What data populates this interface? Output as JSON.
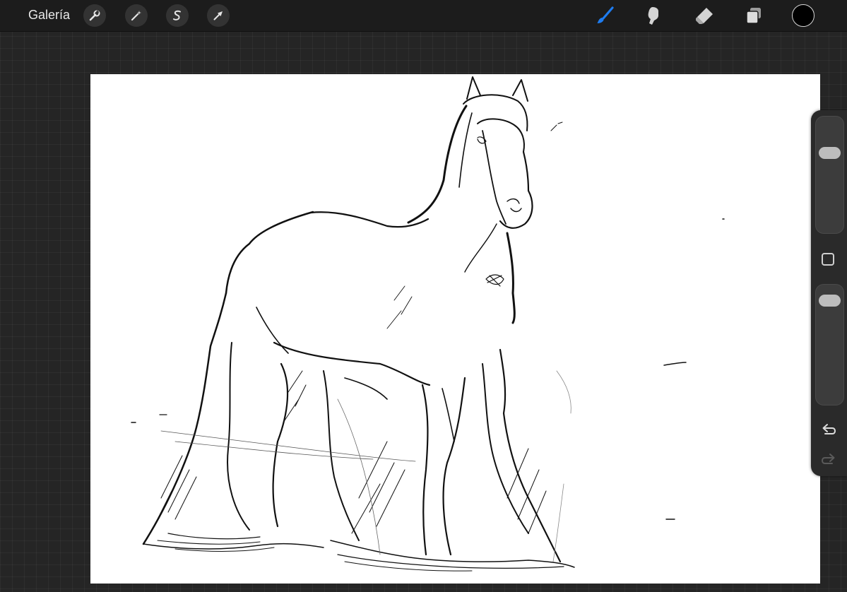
{
  "toolbar": {
    "gallery_label": "Galería",
    "left_tools": [
      "wrench-icon",
      "magic-wand-icon",
      "selection-s-icon",
      "arrow-icon"
    ],
    "right_tools": [
      "brush-icon",
      "smudge-icon",
      "eraser-icon",
      "layers-icon"
    ],
    "active_tool": "brush-icon",
    "active_color": "#1e7cf0",
    "current_color": "#000000"
  },
  "sidebar": {
    "brush_size_level": 0.72,
    "opacity_level": 0.93,
    "icons": [
      "modify-square-icon",
      "undo-icon",
      "redo-icon"
    ]
  },
  "canvas": {
    "background": "#ffffff",
    "content": "horse-sketch"
  }
}
